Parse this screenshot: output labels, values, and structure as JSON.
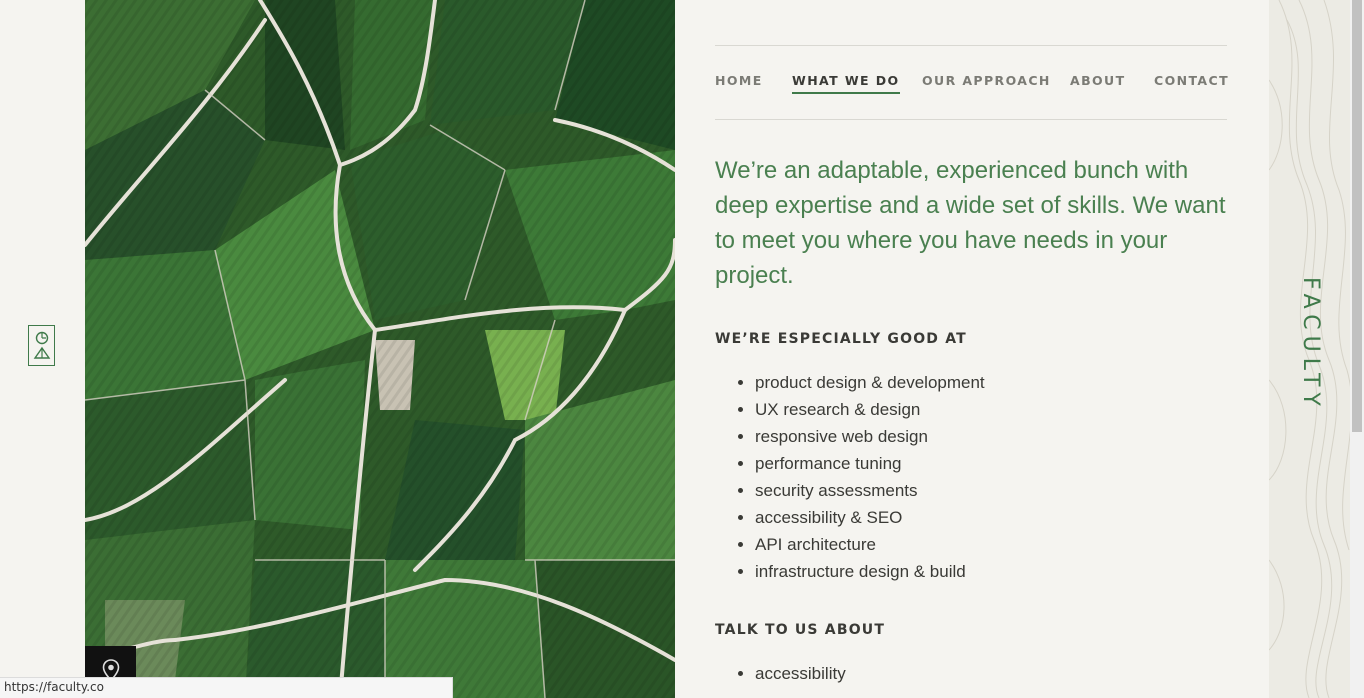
{
  "nav": {
    "items": [
      {
        "label": "HOME",
        "active": false
      },
      {
        "label": "WHAT WE DO",
        "active": true
      },
      {
        "label": "OUR APPROACH",
        "active": false
      },
      {
        "label": "ABOUT",
        "active": false
      },
      {
        "label": "CONTACT",
        "active": false
      }
    ]
  },
  "main": {
    "intro": "We’re an adaptable, experienced bunch with deep expertise and a wide set of skills. We want to meet you where you have needs in your project.",
    "good_at": {
      "heading": "WE’RE ESPECIALLY GOOD AT",
      "items": [
        "product design & development",
        "UX research & design",
        "responsive web design",
        "performance tuning",
        "security assessments",
        "accessibility & SEO",
        "API architecture",
        "infrastructure design & build"
      ]
    },
    "talk_about": {
      "heading": "TALK TO US ABOUT",
      "items": [
        "accessibility"
      ]
    }
  },
  "brand": {
    "name": "FACULTY",
    "color": "#3f7a4a"
  },
  "icons": {
    "logo": "faculty-logo-icon",
    "map_pin": "map-pin-icon"
  },
  "status_bar": {
    "url": "https://faculty.co"
  }
}
